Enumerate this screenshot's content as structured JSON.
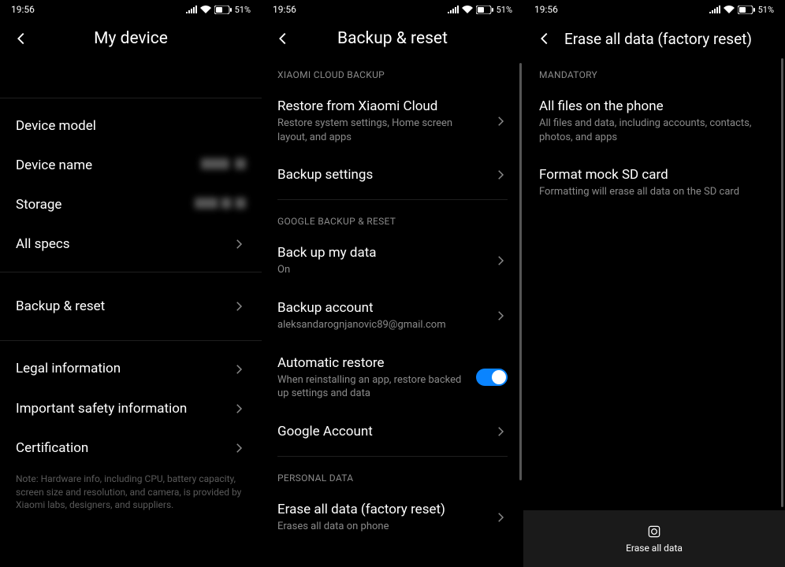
{
  "status": {
    "time": "19:56",
    "battery": "51%"
  },
  "panel1": {
    "title": "My device",
    "rows": {
      "device_model": "Device model",
      "device_name": "Device name",
      "storage": "Storage",
      "all_specs": "All specs",
      "backup_reset": "Backup & reset",
      "legal": "Legal information",
      "safety": "Important safety information",
      "certification": "Certification"
    },
    "note": "Note: Hardware info, including CPU, battery capacity, screen size and resolution, and camera, is provided by Xiaomi labs, designers, and suppliers."
  },
  "panel2": {
    "title": "Backup & reset",
    "sections": {
      "xiaomi": "XIAOMI CLOUD BACKUP",
      "google": "GOOGLE BACKUP & RESET",
      "personal": "PERSONAL DATA"
    },
    "rows": {
      "restore_cloud": {
        "title": "Restore from Xiaomi Cloud",
        "sub": "Restore system settings, Home screen layout, and apps"
      },
      "backup_settings": {
        "title": "Backup settings"
      },
      "backup_data": {
        "title": "Back up my data",
        "sub": "On"
      },
      "backup_account": {
        "title": "Backup account",
        "sub": "aleksandarognjanovic89@gmail.com"
      },
      "auto_restore": {
        "title": "Automatic restore",
        "sub": "When reinstalling an app, restore backed up settings and data"
      },
      "google_account": {
        "title": "Google Account"
      },
      "erase_all": {
        "title": "Erase all data (factory reset)",
        "sub": "Erases all data on phone"
      }
    }
  },
  "panel3": {
    "title": "Erase all data (factory reset)",
    "section": "MANDATORY",
    "rows": {
      "all_files": {
        "title": "All files on the phone",
        "sub": "All files and data, including accounts, contacts, photos, and apps"
      },
      "format_sd": {
        "title": "Format mock SD card",
        "sub": "Formatting will erase all data on the SD card"
      }
    },
    "button": "Erase all data"
  }
}
